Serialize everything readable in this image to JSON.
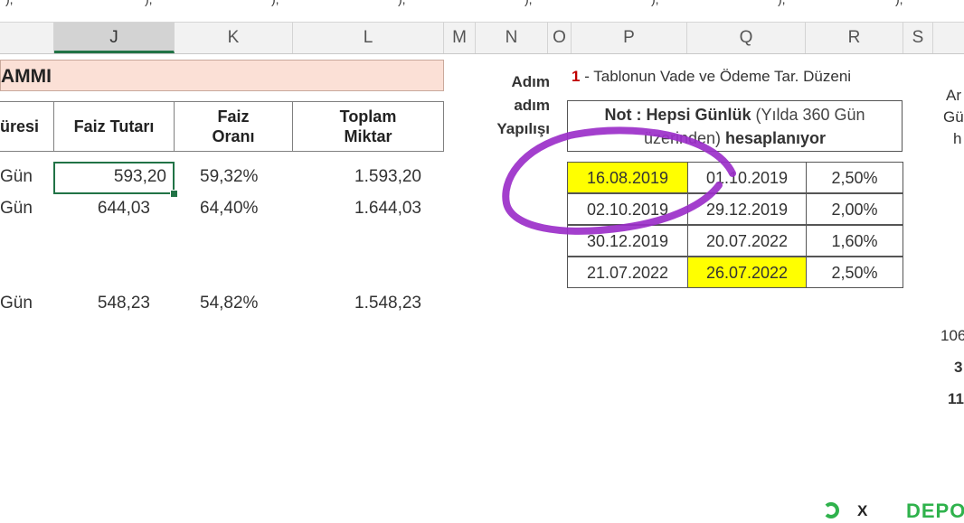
{
  "formula_strip": [
    "), ",
    "), ",
    "), ",
    "), ",
    "), ",
    "), ",
    "), ",
    "), "
  ],
  "columns": [
    "J",
    "K",
    "L",
    "M",
    "N",
    "O",
    "P",
    "Q",
    "R",
    "S"
  ],
  "title": "AMMI",
  "table": {
    "headers": {
      "sure": "üresi",
      "faiz_tutari": "Faiz Tutarı",
      "faiz_orani": [
        "Faiz",
        "Oranı"
      ],
      "toplam": [
        "Toplam",
        "Miktar"
      ]
    },
    "rows": [
      {
        "sure": "Gün",
        "faiz_tutari": "593,20",
        "faiz_orani": "59,32%",
        "toplam": "1.593,20"
      },
      {
        "sure": "Gün",
        "faiz_tutari": "644,03",
        "faiz_orani": "64,40%",
        "toplam": "1.644,03"
      },
      {
        "sure": "Gün",
        "faiz_tutari": "548,23",
        "faiz_orani": "54,82%",
        "toplam": "1.548,23"
      }
    ]
  },
  "adim_label": [
    "Adım",
    "adım",
    "Yapılışı"
  ],
  "note": {
    "number": "1",
    "title": " - Tablonun Vade ve Ödeme Tar. Düzeni",
    "box_bold1": "Not : Hepsi Günlük",
    "box_normal": " (Yılda 360 Gün",
    "box_line2": "üzerinden)",
    "box_bold2": " hesaplanıyor"
  },
  "rates": [
    {
      "from": "16.08.2019",
      "to": "01.10.2019",
      "rate": "2,50%",
      "from_hl": true,
      "to_hl": false
    },
    {
      "from": "02.10.2019",
      "to": "29.12.2019",
      "rate": "2,00%",
      "from_hl": false,
      "to_hl": false
    },
    {
      "from": "30.12.2019",
      "to": "20.07.2022",
      "rate": "1,60%",
      "from_hl": false,
      "to_hl": false
    },
    {
      "from": "21.07.2022",
      "to": "26.07.2022",
      "rate": "2,50%",
      "from_hl": false,
      "to_hl": true
    }
  ],
  "edge_texts": [
    "Ar",
    "Gü",
    "h",
    "106",
    "3",
    "11"
  ],
  "watermark": {
    "text": "X",
    "logo": "DEPO"
  },
  "colors": {
    "highlight": "#ffff00",
    "title_band": "#fbe0d6",
    "excel_green": "#217346",
    "annotation_purple": "#9b2fc9"
  }
}
